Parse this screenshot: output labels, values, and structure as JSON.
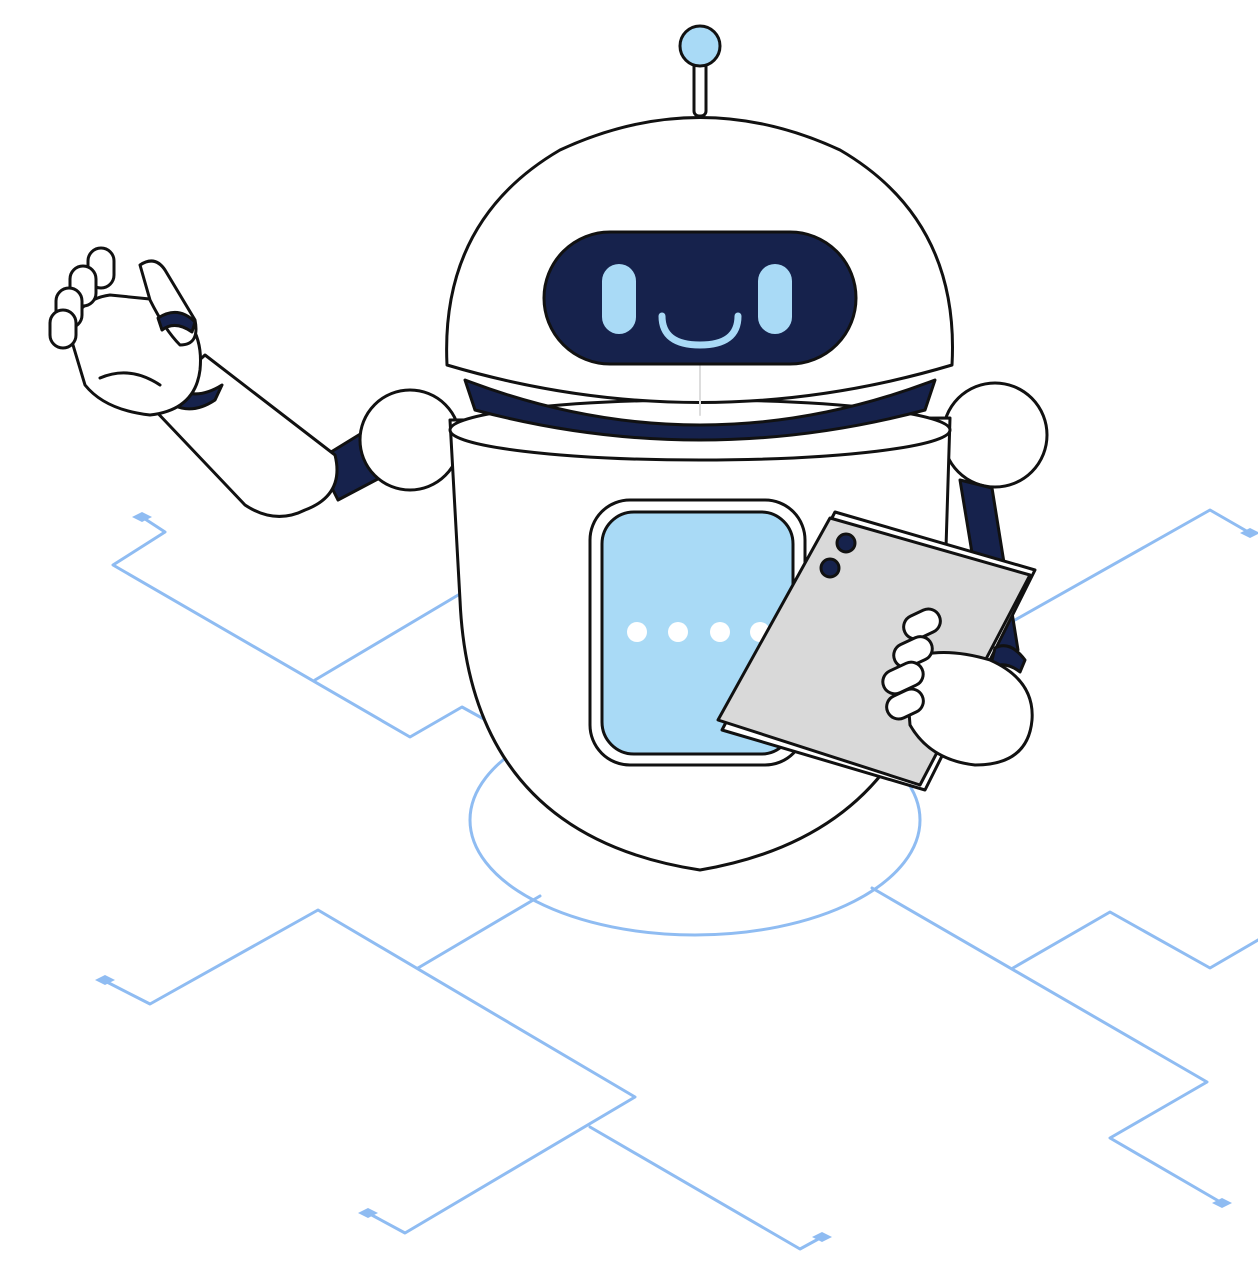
{
  "illustration": {
    "subject": "robot-holding-tablet",
    "colors": {
      "background": "#ffffff",
      "outline": "#111111",
      "navy": "#16224c",
      "light_blue": "#a9daf6",
      "circuit_blue": "#8fbcf2",
      "tablet_gray": "#d9d9d9",
      "white": "#ffffff"
    },
    "icons": {
      "antenna": "antenna-ball",
      "face": "smile-face",
      "chest": "typing-dots",
      "device": "tablet"
    }
  }
}
